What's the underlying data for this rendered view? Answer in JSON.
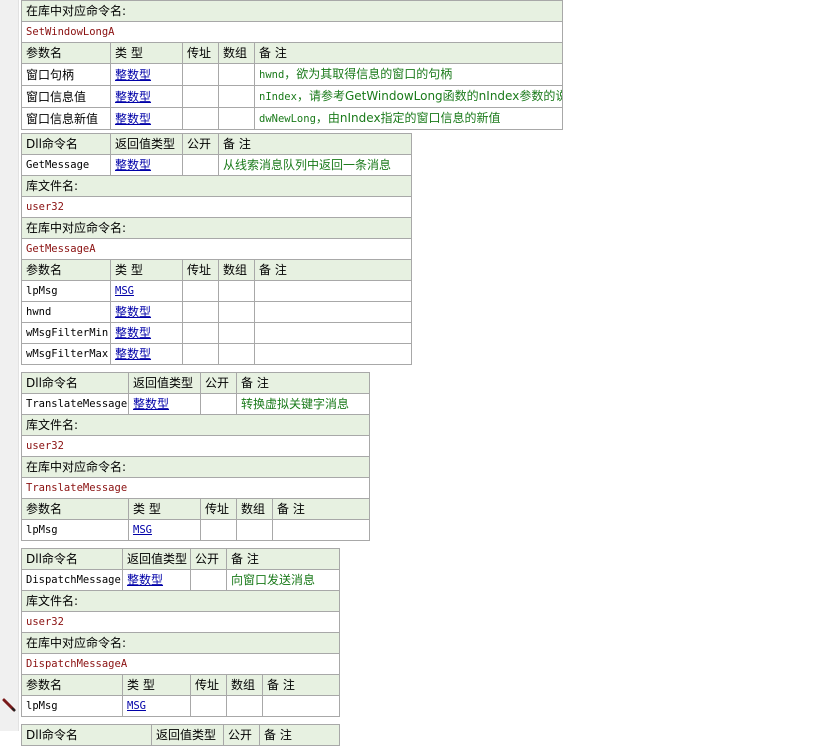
{
  "labels": {
    "dll_cmd": "Dll命令名",
    "ret_type": "返回值类型",
    "public": "公开",
    "remark": "备 注",
    "lib_file": "库文件名:",
    "lib_cmd": "在库中对应命令名:",
    "param_name": "参数名",
    "type": "类 型",
    "byref": "传址",
    "array": "数组"
  },
  "set_window_long": {
    "lib_cmd_value": "SetWindowLongA",
    "params": [
      {
        "name": "窗口句柄",
        "type": "整数型",
        "note_code": "hwnd",
        "note_text": "，欲为其取得信息的窗口的句柄"
      },
      {
        "name": "窗口信息值",
        "type": "整数型",
        "note_code": "nIndex",
        "note_text": "，请参考GetWindowLong函数的nIndex参数的说明"
      },
      {
        "name": "窗口信息新值",
        "type": "整数型",
        "note_code": "dwNewLong",
        "note_text": "，由nIndex指定的窗口信息的新值"
      }
    ]
  },
  "get_message": {
    "name": "GetMessage",
    "ret_type": "整数型",
    "remark": "从线索消息队列中返回一条消息",
    "lib": "user32",
    "lib_cmd_value": "GetMessageA",
    "params": [
      {
        "name": "lpMsg",
        "type": "MSG"
      },
      {
        "name": "hwnd",
        "type": "整数型"
      },
      {
        "name": "wMsgFilterMin",
        "type": "整数型"
      },
      {
        "name": "wMsgFilterMax",
        "type": "整数型"
      }
    ]
  },
  "translate_message": {
    "name": "TranslateMessage",
    "ret_type": "整数型",
    "remark": "转换虚拟关键字消息",
    "lib": "user32",
    "lib_cmd_value": "TranslateMessage",
    "params": [
      {
        "name": "lpMsg",
        "type": "MSG"
      }
    ]
  },
  "dispatch_message": {
    "name": "DispatchMessage",
    "ret_type": "整数型",
    "remark": "向窗口发送消息",
    "lib": "user32",
    "lib_cmd_value": "DispatchMessageA",
    "params": [
      {
        "name": "lpMsg",
        "type": "MSG"
      }
    ]
  },
  "next_block": {
    "ret_type": "返回值类型",
    "public": "公开",
    "remark": "备 注"
  }
}
